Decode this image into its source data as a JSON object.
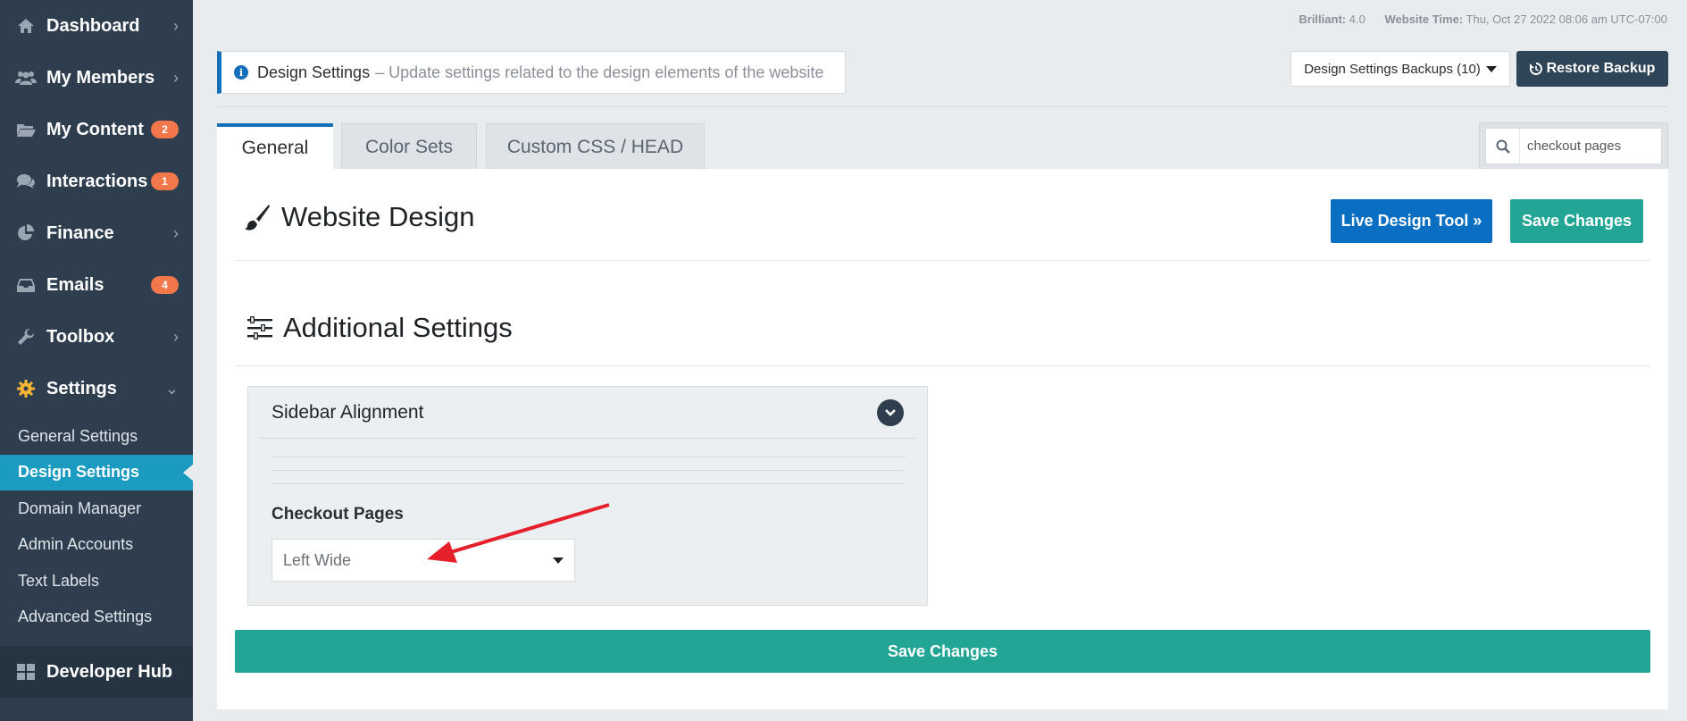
{
  "sidebar": {
    "items": [
      {
        "label": "Dashboard",
        "icon": "dashboard-icon",
        "badge": "",
        "chevron": "›"
      },
      {
        "label": "My Members",
        "icon": "members-icon",
        "badge": "",
        "chevron": "›"
      },
      {
        "label": "My Content",
        "icon": "folder-icon",
        "badge": "2",
        "chevron": ""
      },
      {
        "label": "Interactions",
        "icon": "comments-icon",
        "badge": "1",
        "chevron": ""
      },
      {
        "label": "Finance",
        "icon": "pie-chart-icon",
        "badge": "",
        "chevron": "›"
      },
      {
        "label": "Emails",
        "icon": "inbox-icon",
        "badge": "4",
        "chevron": ""
      },
      {
        "label": "Toolbox",
        "icon": "wrench-icon",
        "badge": "",
        "chevron": "›"
      },
      {
        "label": "Settings",
        "icon": "gear-icon",
        "badge": "",
        "chevron": "⌄"
      }
    ],
    "subitems": [
      {
        "label": "General Settings"
      },
      {
        "label": "Design Settings"
      },
      {
        "label": "Domain Manager"
      },
      {
        "label": "Admin Accounts"
      },
      {
        "label": "Text Labels"
      },
      {
        "label": "Advanced Settings"
      }
    ],
    "devhub": {
      "label": "Developer Hub",
      "icon": "grid-icon"
    }
  },
  "meta": {
    "version_label": "Brilliant:",
    "version_value": "4.0",
    "time_label": "Website Time:",
    "time_value": "Thu, Oct 27 2022 08:06 am UTC-07:00"
  },
  "infobar": {
    "title": "Design Settings",
    "description": "– Update settings related to the design elements of the website"
  },
  "backups": {
    "label": "Design Settings Backups (10)"
  },
  "restore": {
    "label": "Restore Backup"
  },
  "tabs": [
    {
      "label": "General"
    },
    {
      "label": "Color Sets"
    },
    {
      "label": "Custom CSS / HEAD"
    }
  ],
  "search": {
    "value": "checkout pages"
  },
  "main": {
    "title": "Website Design",
    "live_button": "Live Design Tool »",
    "save_top": "Save Changes",
    "additional_title": "Additional Settings",
    "accordion_title": "Sidebar Alignment",
    "field_label": "Checkout Pages",
    "select_value": "Left Wide",
    "save_bottom": "Save Changes"
  },
  "colors": {
    "sidebar_bg": "#2e3e4e",
    "active_sub": "#1a9bbf",
    "badge": "#f2784b",
    "primary_blue": "#0a6ec2",
    "teal": "#22a595",
    "arrow_red": "#e5202a"
  }
}
